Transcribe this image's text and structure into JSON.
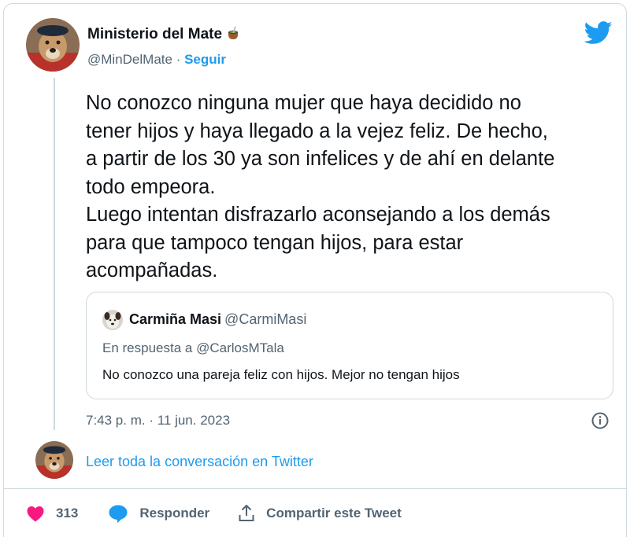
{
  "author": {
    "name": "Ministerio del Mate",
    "handle": "@MinDelMate",
    "separator": "·",
    "follow_label": "Seguir",
    "avatar_icon": "dog-portrait-avatar",
    "name_emoji_icon": "mate-gourd-icon"
  },
  "platform": {
    "logo_icon": "twitter-bird-icon",
    "brand_color": "#1d9bf0"
  },
  "tweet": {
    "text": "No conozco ninguna mujer que haya decidido no\ntener hijos y haya llegado a la vejez feliz. De hecho,\na partir de los 30 ya son infelices y de ahí en delante\ntodo empeora.\nLuego intentan disfrazarlo aconsejando a los demás\npara que tampoco tengan hijos, para estar\nacompañadas.",
    "timestamp": "7:43 p. m. · 11 jun. 2023"
  },
  "quoted_tweet": {
    "name": "Carmiña Masi",
    "handle": "@CarmiMasi",
    "reply_context": "En respuesta a @CarlosMTala",
    "text": "No conozco una pareja feliz con hijos. Mejor no tengan hijos",
    "avatar_icon": "dog-avatar"
  },
  "read_conversation_label": "Leer toda la conversación en Twitter",
  "actions": {
    "like_count": "313",
    "reply_label": "Responder",
    "share_label": "Compartir este Tweet",
    "like_color": "#f91880",
    "reply_color": "#1d9bf0"
  }
}
